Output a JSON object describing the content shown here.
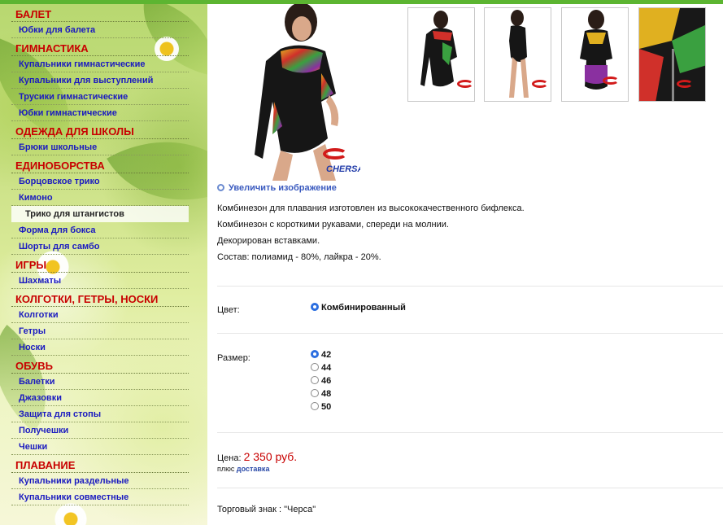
{
  "sidebar": {
    "sections": [
      {
        "title": "БАЛЕТ",
        "items": [
          "Юбки для балета"
        ]
      },
      {
        "title": "ГИМНАСТИКА",
        "items": [
          "Купальники гимнастические",
          "Купальники для выступлений",
          "Трусики гимнастические",
          "Юбки гимнастические"
        ]
      },
      {
        "title": "ОДЕЖДА ДЛЯ ШКОЛЫ",
        "items": [
          "Брюки школьные"
        ]
      },
      {
        "title": "ЕДИНОБОРСТВА",
        "items": [
          "Борцовское трико",
          "Кимоно",
          "Трико для штангистов",
          "Форма для бокса",
          "Шорты для самбо"
        ]
      },
      {
        "title": "ИГРЫ",
        "items": [
          "Шахматы"
        ]
      },
      {
        "title": "КОЛГОТКИ, ГЕТРЫ, НОСКИ",
        "items": [
          "Колготки",
          "Гетры",
          "Носки"
        ]
      },
      {
        "title": "ОБУВЬ",
        "items": [
          "Балетки",
          "Джазовки",
          "Защита для стопы",
          "Получешки",
          "Чешки"
        ]
      },
      {
        "title": "ПЛАВАНИЕ",
        "items": [
          "Купальники раздельные",
          "Купальники совместные"
        ]
      }
    ],
    "active_item": "Трико для штангистов"
  },
  "product": {
    "brand_logo_text": "CHERSA",
    "enlarge_link": "Увеличить изображение",
    "description": [
      "Комбинезон для плавания изготовлен из высококачественного бифлекса.",
      "Комбинезон с короткими рукавами, спереди на молнии.",
      "Декорирован вставками.",
      "Состав: полиамид - 80%, лайкра - 20%."
    ],
    "color_label": "Цвет:",
    "color_options": [
      {
        "label": "Комбинированный",
        "selected": true
      }
    ],
    "size_label": "Размер:",
    "size_options": [
      {
        "label": "42",
        "selected": true
      },
      {
        "label": "44",
        "selected": false
      },
      {
        "label": "46",
        "selected": false
      },
      {
        "label": "48",
        "selected": false
      },
      {
        "label": "50",
        "selected": false
      }
    ],
    "price_label": "Цена:",
    "price_value": "2 350 руб.",
    "plus_text": "плюс",
    "delivery_link": "доставка",
    "trademark": "Торговый знак : \"Черса\""
  },
  "colors": {
    "accent_green": "#5cb531",
    "category_red": "#c80000",
    "link_blue": "#1a1ac0",
    "price_red": "#c80000"
  }
}
